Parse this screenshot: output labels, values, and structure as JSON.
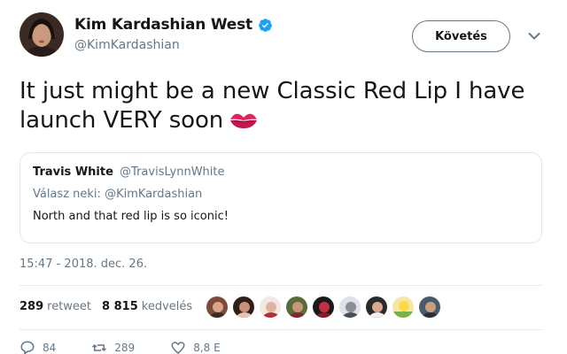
{
  "author": {
    "display_name": "Kim Kardashian West",
    "handle": "@KimKardashian",
    "verified": true,
    "avatar_icon": "profile-photo"
  },
  "follow_label": "Követés",
  "tweet": {
    "text": "It just might be a new Classic Red Lip I have launch VERY soon",
    "emoji_icon": "kiss-mark-icon"
  },
  "quoted": {
    "name": "Travis White",
    "handle": "@TravisLynnWhite",
    "reply_prefix": "Válasz neki:",
    "reply_handle": "@KimKardashian",
    "text": "North and that red lip is so iconic!"
  },
  "timestamp": "15:47 - 2018. dec. 26.",
  "stats": {
    "retweets_count": "289",
    "retweets_label": "retweet",
    "likes_count": "8 815",
    "likes_label": "kedvelés"
  },
  "actions": {
    "reply_count": "84",
    "retweet_count": "289",
    "like_count": "8,8 E"
  },
  "colors": {
    "text": "#14171a",
    "secondary": "#657786",
    "verified": "#1da1f2",
    "border": "#e1e8ed",
    "kiss": "#e0245e"
  }
}
